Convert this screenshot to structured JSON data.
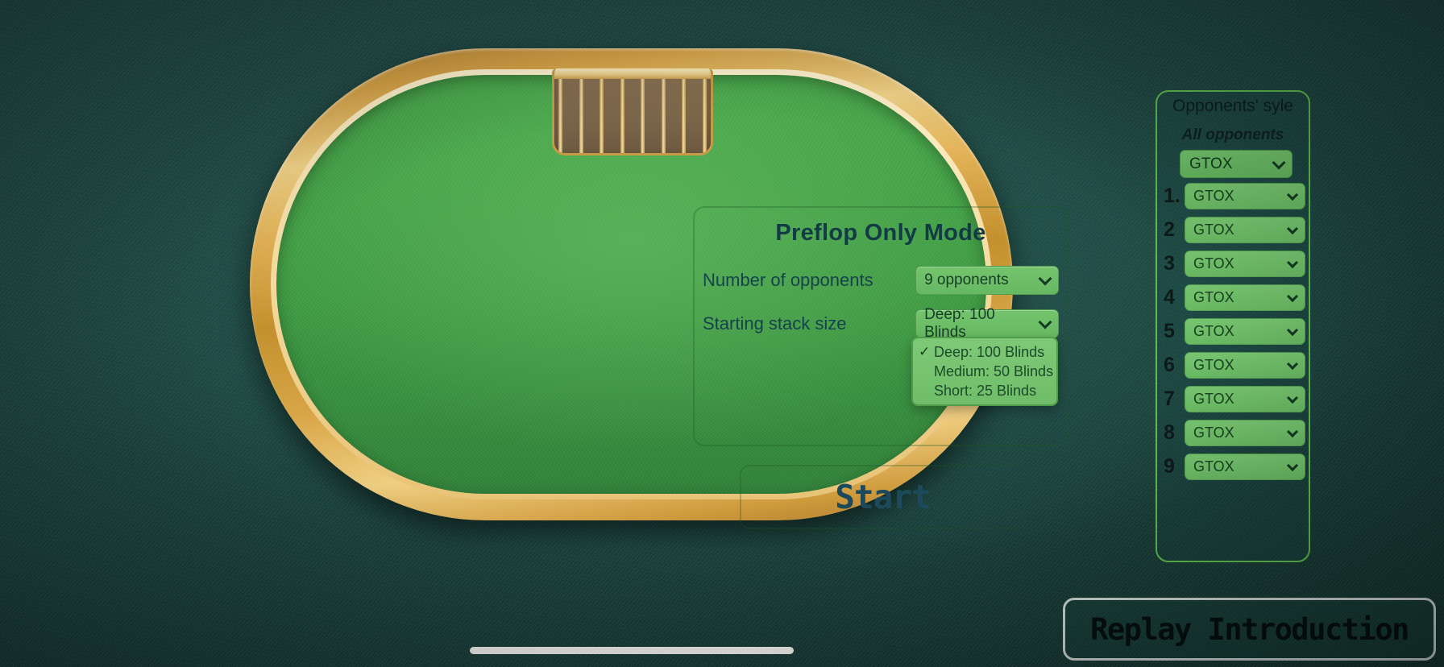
{
  "background": {
    "felt_color": "#1e4b46"
  },
  "table": {
    "rail_color": "#d9a64a",
    "felt_color": "#3f9f43",
    "chip_rack": {
      "name": "chip-rack",
      "slot_count": 8
    }
  },
  "settings": {
    "title": "Preflop Only Mode",
    "rows": [
      {
        "label": "Number of opponents",
        "value": "9 opponents"
      },
      {
        "label": "Starting stack size",
        "value": "Deep: 100 Blinds"
      }
    ],
    "stack_dropdown": {
      "open": true,
      "selected": "Deep: 100 Blinds",
      "check_glyph": "✓",
      "options": [
        "Deep: 100 Blinds",
        "Medium: 50 Blinds",
        "Short: 25 Blinds"
      ]
    },
    "start_label": "Start"
  },
  "opponents_panel": {
    "title": "Opponents' syle",
    "all_label": "All opponents",
    "all_value": "GTOX",
    "rows": [
      {
        "index": "1.",
        "value": "GTOX"
      },
      {
        "index": "2",
        "value": "GTOX"
      },
      {
        "index": "3",
        "value": "GTOX"
      },
      {
        "index": "4",
        "value": "GTOX"
      },
      {
        "index": "5",
        "value": "GTOX"
      },
      {
        "index": "6",
        "value": "GTOX"
      },
      {
        "index": "7",
        "value": "GTOX"
      },
      {
        "index": "8",
        "value": "GTOX"
      },
      {
        "index": "9",
        "value": "GTOX"
      }
    ]
  },
  "replay": {
    "label": "Replay Introduction"
  }
}
